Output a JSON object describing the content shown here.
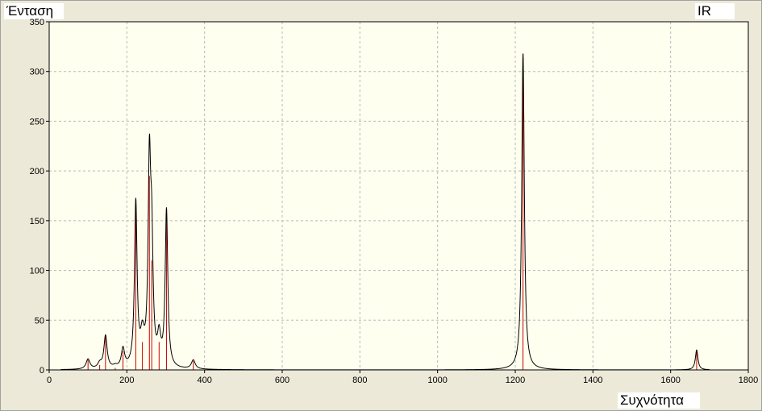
{
  "chart_data": {
    "type": "line",
    "title": "",
    "ylabel": "Ένταση",
    "xlabel": "Συχνότητα",
    "legend": "IR",
    "xlim": [
      0,
      1800
    ],
    "ylim": [
      0,
      350
    ],
    "x_ticks": [
      0,
      200,
      400,
      600,
      800,
      1000,
      1200,
      1400,
      1600,
      1800
    ],
    "y_ticks": [
      0,
      50,
      100,
      150,
      200,
      250,
      300,
      350
    ],
    "grid": true,
    "colors": {
      "plot_bg": "#fffff0",
      "grid": "#b8b8b8",
      "spectrum_line": "#000000",
      "stick_lines": "#cc0000",
      "window_bg": "#ece9d8"
    },
    "spectrum_range": [
      30,
      1700
    ],
    "peaks": [
      {
        "freq": 100,
        "intensity": 10,
        "width": 6
      },
      {
        "freq": 130,
        "intensity": 5,
        "width": 6
      },
      {
        "freq": 145,
        "intensity": 33,
        "width": 5
      },
      {
        "freq": 170,
        "intensity": 2,
        "width": 6
      },
      {
        "freq": 190,
        "intensity": 19,
        "width": 5
      },
      {
        "freq": 223,
        "intensity": 165,
        "width": 4
      },
      {
        "freq": 240,
        "intensity": 28,
        "width": 6
      },
      {
        "freq": 258,
        "intensity": 195,
        "width": 4
      },
      {
        "freq": 264,
        "intensity": 110,
        "width": 4
      },
      {
        "freq": 283,
        "intensity": 28,
        "width": 5
      },
      {
        "freq": 302,
        "intensity": 158,
        "width": 4
      },
      {
        "freq": 371,
        "intensity": 9,
        "width": 6
      },
      {
        "freq": 1220,
        "intensity": 318,
        "width": 4
      },
      {
        "freq": 1667,
        "intensity": 20,
        "width": 4
      }
    ]
  }
}
